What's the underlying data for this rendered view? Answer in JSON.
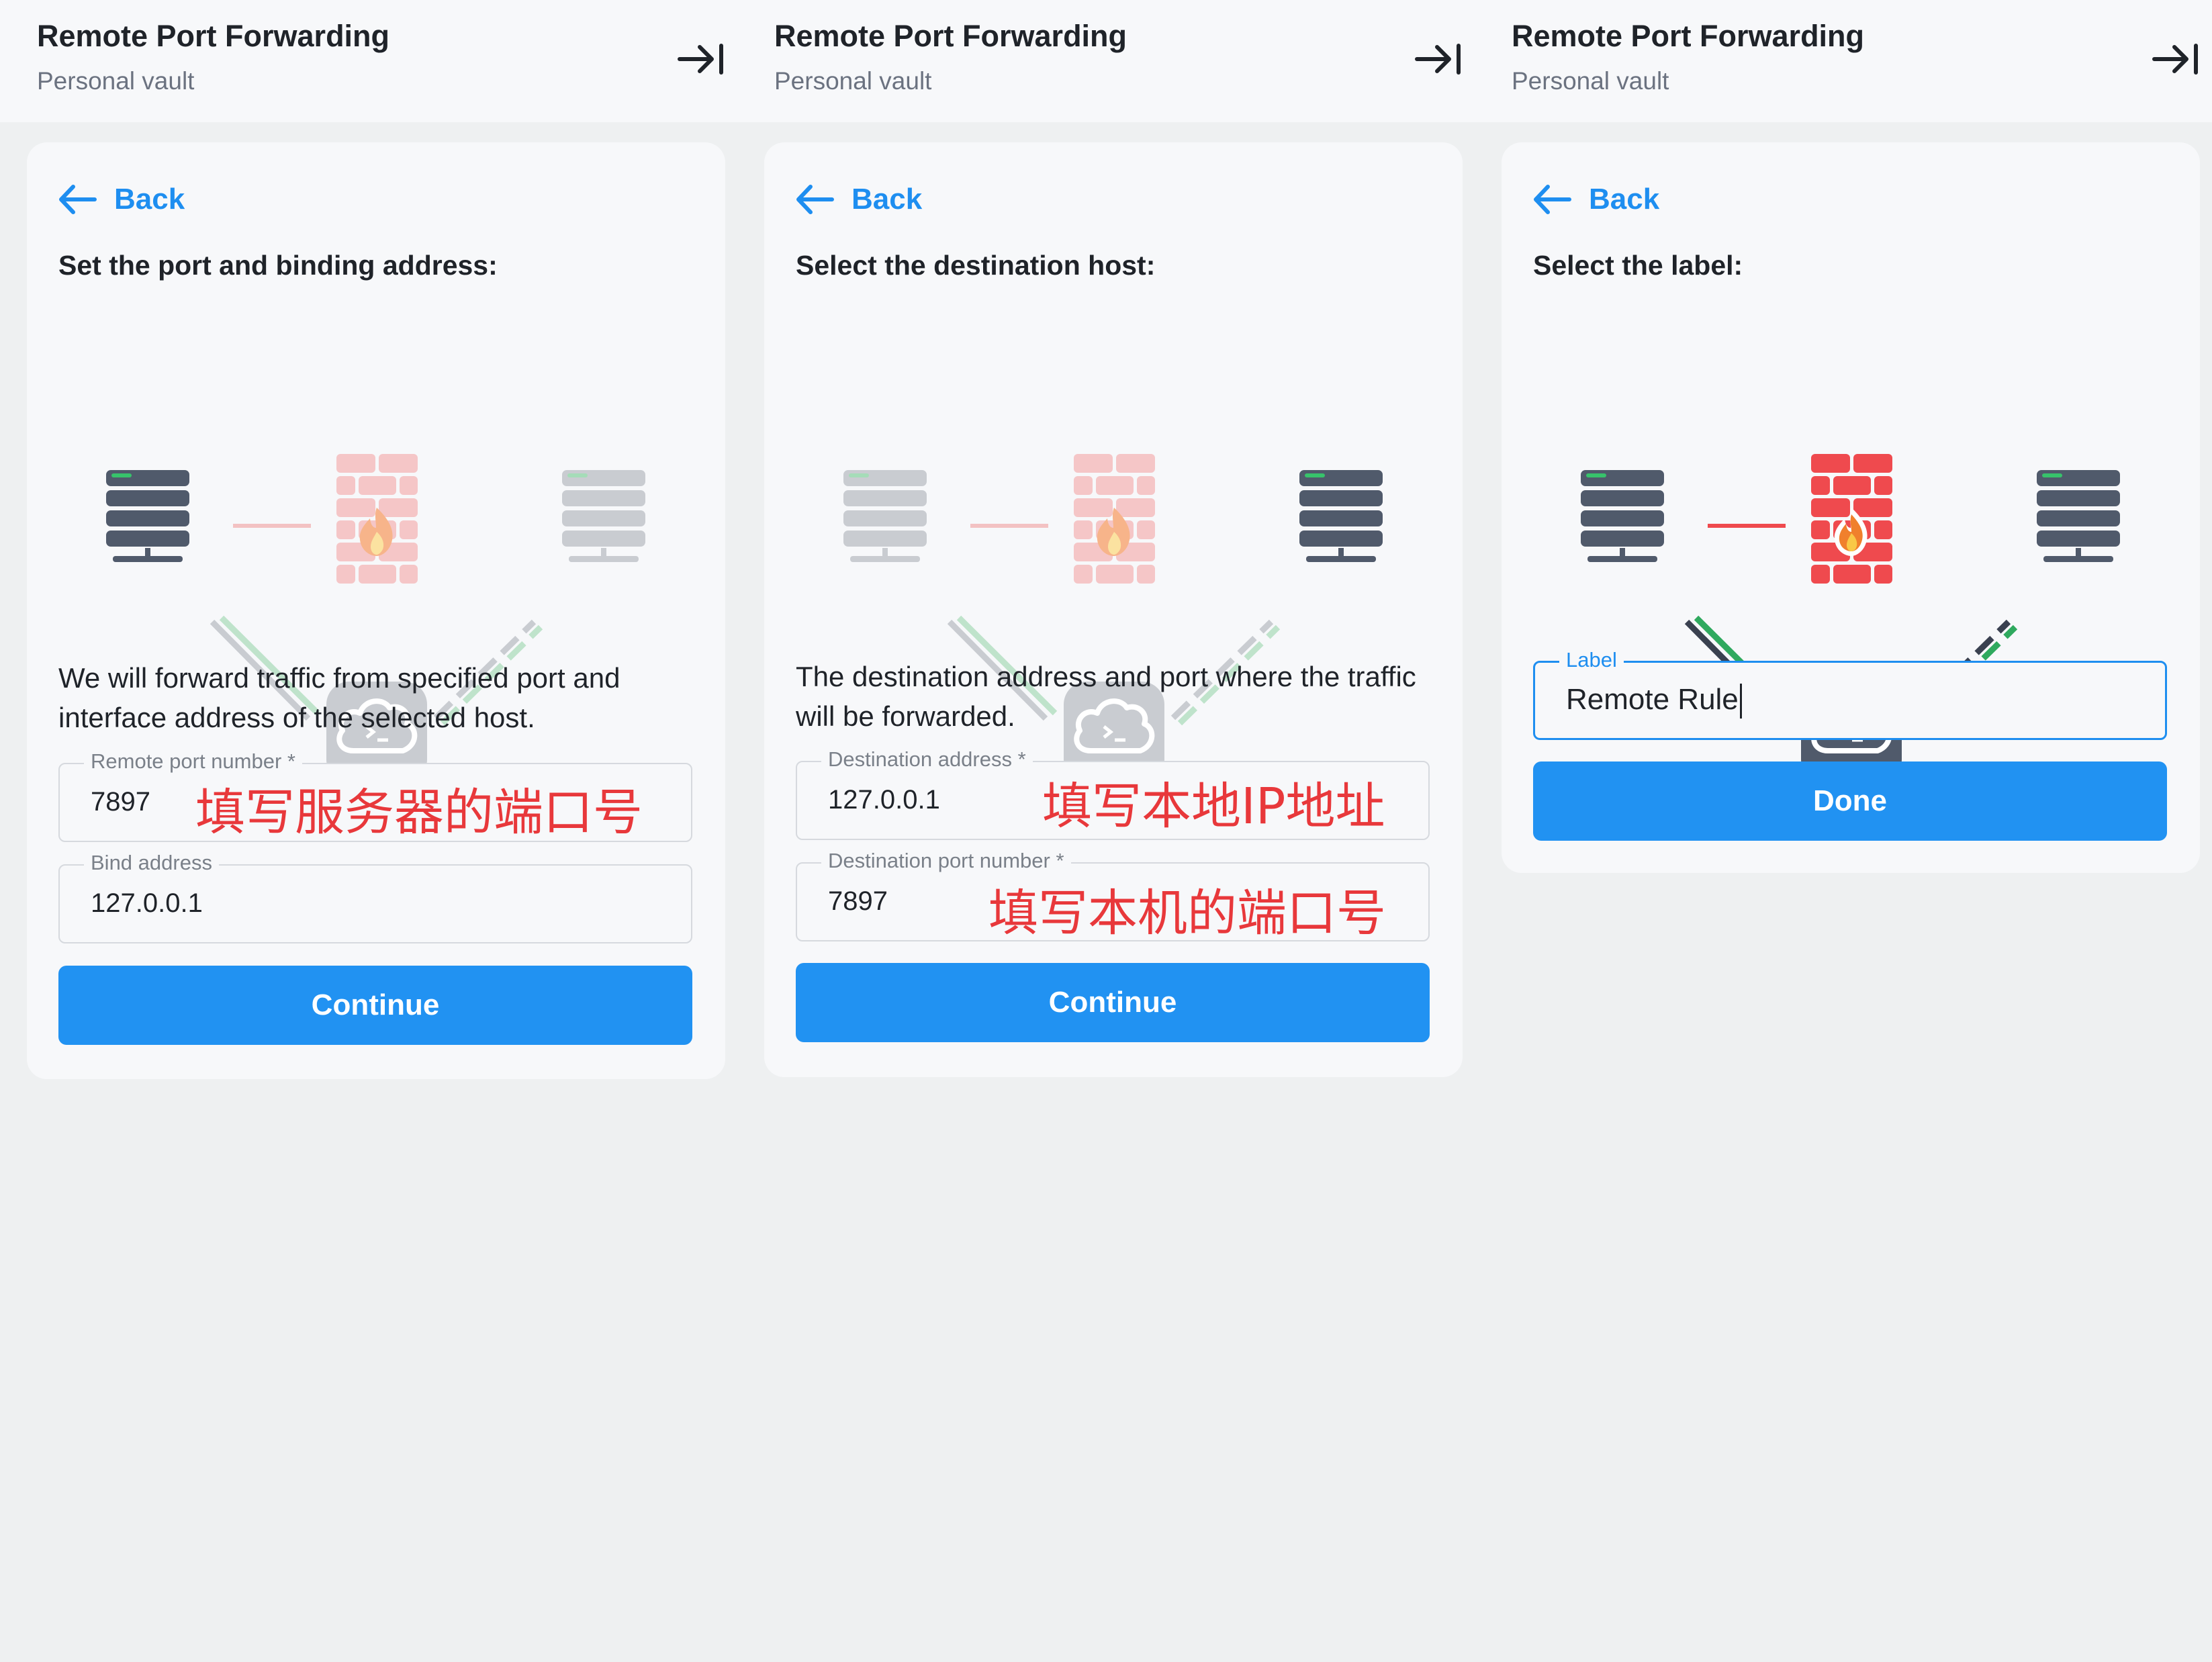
{
  "colors": {
    "accent": "#2192f2",
    "link": "#1e8ef0",
    "server_dark": "#505a6b",
    "server_light": "#c9ccd1",
    "firewall_red": "#ef4a4e",
    "firewall_light": "#f5c6c7",
    "link_green": "#2fa95e",
    "annotation_red": "#e8383b"
  },
  "screens": [
    {
      "header": {
        "title": "Remote Port Forwarding",
        "subtitle": "Personal vault",
        "collapse_icon": "arrow-right-to-bar-icon"
      },
      "back_label": "Back",
      "step_title": "Set the port and binding address:",
      "description": "We will forward traffic from specified port and interface address of the selected host.",
      "fields": [
        {
          "label": "Remote port number *",
          "value": "7897",
          "annotation": "填写服务器的端口号"
        },
        {
          "label": "Bind address",
          "value": "127.0.0.1"
        }
      ],
      "button": "Continue"
    },
    {
      "header": {
        "title": "Remote Port Forwarding",
        "subtitle": "Personal vault",
        "collapse_icon": "arrow-right-to-bar-icon"
      },
      "back_label": "Back",
      "step_title": "Select the destination host:",
      "description": "The destination address and port where the traffic will be forwarded.",
      "fields": [
        {
          "label": "Destination address *",
          "value": "127.0.0.1",
          "annotation": "填写本地IP地址"
        },
        {
          "label": "Destination port number *",
          "value": "7897",
          "annotation": "填写本机的端口号"
        }
      ],
      "button": "Continue"
    },
    {
      "header": {
        "title": "Remote Port Forwarding",
        "subtitle": "Personal vault",
        "collapse_icon": "arrow-right-to-bar-icon"
      },
      "back_label": "Back",
      "step_title": "Select the label:",
      "fields": [
        {
          "label": "Label",
          "value": "Remote Rule"
        }
      ],
      "button": "Done"
    }
  ]
}
